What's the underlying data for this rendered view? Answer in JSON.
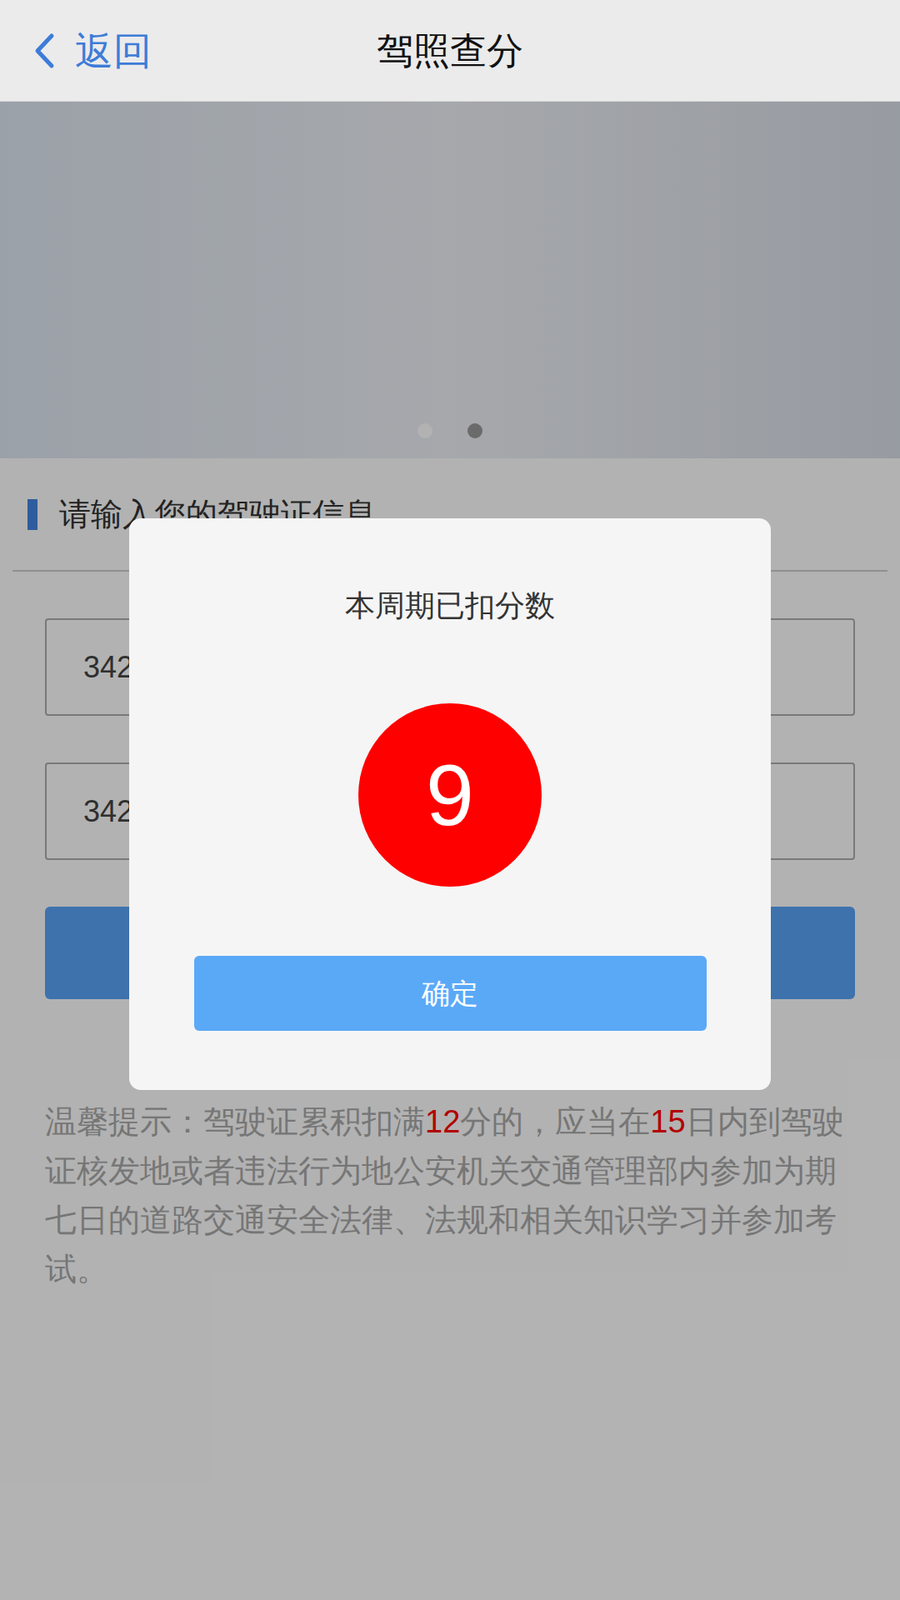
{
  "header": {
    "back_label": "返回",
    "title": "驾照查分"
  },
  "banner": {
    "dots": [
      {
        "selected": true
      },
      {
        "selected": false
      }
    ]
  },
  "form": {
    "section_title": "请输入您的驾驶证信息",
    "fields": [
      {
        "value": "342"
      },
      {
        "value": "342"
      }
    ]
  },
  "tip": {
    "segments": [
      {
        "text": "温馨提示：驾驶证累积扣满",
        "highlight": false
      },
      {
        "text": "12",
        "highlight": true
      },
      {
        "text": "分的，应当在",
        "highlight": false
      },
      {
        "text": "15",
        "highlight": true
      },
      {
        "text": "日内到驾驶证核发地或者违法行为地公安机关交通管理部内参加为期七日的道路交通安全法律、法规和相关知识学习并参加考试。",
        "highlight": false
      }
    ]
  },
  "dialog": {
    "title": "本周期已扣分数",
    "points": "9",
    "confirm_label": "确定"
  }
}
